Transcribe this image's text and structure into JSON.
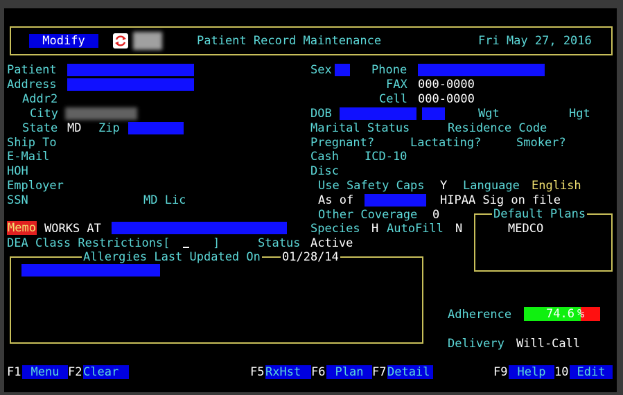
{
  "header": {
    "mode_label": "Modify",
    "screen_title": "Patient Record Maintenance",
    "date": "Fri May 27, 2016"
  },
  "labels": {
    "patient": "Patient",
    "address": "Address",
    "addr2": "Addr2",
    "city": "City",
    "state": "State",
    "zip": "Zip",
    "ship_to": "Ship To",
    "email": "E-Mail",
    "hoh": "HOH",
    "employer": "Employer",
    "ssn": "SSN",
    "md_lic": "MD Lic",
    "memo": "Memo",
    "dea": "DEA Class Restrictions[",
    "dea_close": "]",
    "status": "Status",
    "allergies": "Allergies Last Updated On",
    "sex": "Sex",
    "phone": "Phone",
    "fax": "FAX",
    "cell": "Cell",
    "dob": "DOB",
    "wgt": "Wgt",
    "hgt": "Hgt",
    "marital": "Marital Status",
    "residence": "Residence Code",
    "pregnant": "Pregnant?",
    "lactating": "Lactating?",
    "smoker": "Smoker?",
    "cash": "Cash",
    "icd": "ICD-10",
    "disc": "Disc",
    "safety_caps": "Use Safety Caps",
    "language": "Language",
    "as_of": "As of",
    "other_cov": "Other Coverage",
    "default_plans": "Default Plans",
    "species": "Species",
    "autofill": "AutoFill",
    "adherence": "Adherence",
    "delivery": "Delivery"
  },
  "values": {
    "state": "MD",
    "memo": "WORKS AT",
    "status": "Active",
    "allergies_date": "01/28/14",
    "fax": "000-0000",
    "cell": "000-0000",
    "safety_caps": "Y",
    "language": "English",
    "hipaa": "HIPAA Sig on file",
    "other_cov": "0",
    "species": "H",
    "autofill": "N",
    "default_plan": "MEDCO",
    "adherence_text": "74.6",
    "adherence_pct_sign": "%",
    "adherence_fraction": 0.746,
    "delivery": "Will-Call"
  },
  "fkeys": [
    {
      "key": "F1",
      "label": "Menu"
    },
    {
      "key": "F2",
      "label": "Clear"
    },
    {
      "key": "F5",
      "label": "RxHst"
    },
    {
      "key": "F6",
      "label": "Plan"
    },
    {
      "key": "F7",
      "label": "Detail"
    },
    {
      "key": "F9",
      "label": "Help"
    },
    {
      "key": "10",
      "label": "Edit"
    }
  ],
  "colors": {
    "label": "#5cd8d8",
    "value": "#ffffff",
    "highlight": "#f0e070",
    "field": "#1010ff",
    "border": "#c8bf5a",
    "memo_tag": "#e02020",
    "adherence_good": "#10f010",
    "adherence_bad": "#ff1010"
  }
}
